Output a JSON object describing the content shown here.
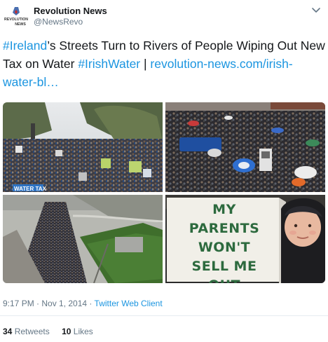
{
  "author": {
    "name": "Revolution News",
    "handle": "@NewsRevo",
    "avatar_text_top": "REVOLUTION",
    "avatar_text_bottom": "NEWS"
  },
  "tweet": {
    "hashtag1": "#Ireland",
    "text1": "’s Streets Turn to Rivers of People Wiping Out New Tax on Water ",
    "hashtag2": "#IrishWater",
    "sep": " | ",
    "url": "revolution-news.com/irish-water-bl…"
  },
  "media": {
    "sign_line1": "MY PARENTS",
    "sign_line2": "WON'T",
    "sign_line3": "SELL ME",
    "sign_line4": "OUT",
    "banner_text": "WATER TAX"
  },
  "meta": {
    "time": "9:17 PM · Nov 1, 2014",
    "dot": " · ",
    "via": "Twitter Web Client"
  },
  "stats": {
    "retweets_count": "34",
    "retweets_label": "Retweets",
    "likes_count": "10",
    "likes_label": "Likes"
  },
  "icons": {
    "caret": "chevron-down-icon"
  },
  "colors": {
    "link": "#1b95e0",
    "secondary_text": "#657786",
    "primary_text": "#14171a"
  }
}
